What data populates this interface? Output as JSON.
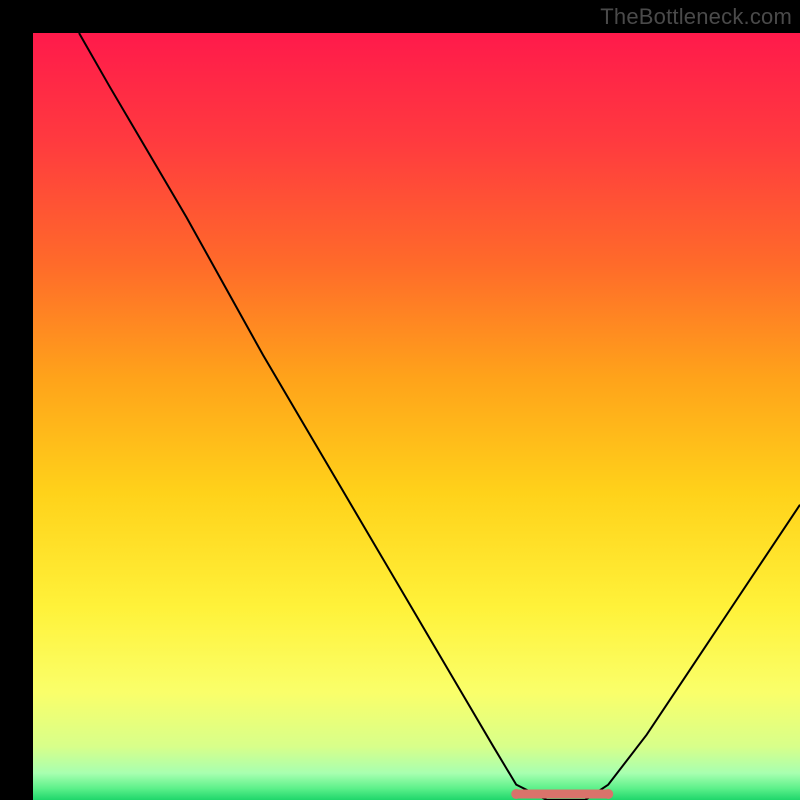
{
  "watermark": "TheBottleneck.com",
  "chart_data": {
    "type": "line",
    "title": "",
    "xlabel": "",
    "ylabel": "",
    "xlim": [
      0,
      100
    ],
    "ylim": [
      0,
      100
    ],
    "series": [
      {
        "name": "bottleneck-curve",
        "x": [
          6,
          10,
          15,
          20,
          25,
          30,
          35,
          40,
          45,
          50,
          55,
          60,
          63,
          67,
          72,
          75,
          80,
          85,
          90,
          95,
          100
        ],
        "values": [
          100,
          93,
          84.5,
          76,
          67,
          58,
          49.5,
          41,
          32.5,
          24,
          15.5,
          7,
          2,
          0,
          0,
          2,
          8.5,
          16,
          23.5,
          31,
          38.5
        ]
      }
    ],
    "flat_zone": {
      "x_start": 63,
      "x_end": 75,
      "y": 0
    },
    "gradient_stops": [
      {
        "pos": 0.0,
        "color": "#ff1a4b"
      },
      {
        "pos": 0.14,
        "color": "#ff3a3f"
      },
      {
        "pos": 0.3,
        "color": "#ff6a2a"
      },
      {
        "pos": 0.45,
        "color": "#ffa31a"
      },
      {
        "pos": 0.6,
        "color": "#ffd21a"
      },
      {
        "pos": 0.75,
        "color": "#fff23a"
      },
      {
        "pos": 0.86,
        "color": "#faff6a"
      },
      {
        "pos": 0.93,
        "color": "#d8ff8a"
      },
      {
        "pos": 0.965,
        "color": "#a8ffb0"
      },
      {
        "pos": 0.985,
        "color": "#5cf08a"
      },
      {
        "pos": 1.0,
        "color": "#1fd66b"
      }
    ],
    "marker_color": "#d9736b",
    "curve_color": "#000000",
    "grid": false,
    "legend": false
  }
}
